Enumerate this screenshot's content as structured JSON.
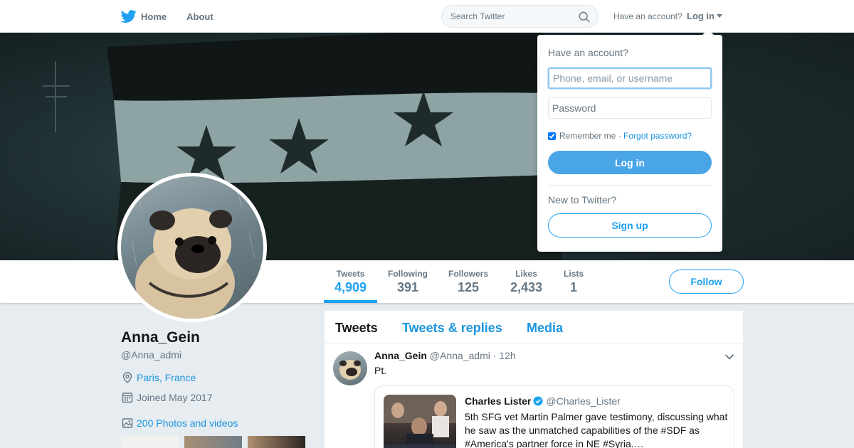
{
  "topnav": {
    "home_label": "Home",
    "about_label": "About",
    "search_placeholder": "Search Twitter",
    "have_account": "Have an account?",
    "login_label": "Log in"
  },
  "profile": {
    "name": "Anna_Gein",
    "handle": "@Anna_admi",
    "location": "Paris, France",
    "joined": "Joined May 2017",
    "photos_link": "200 Photos and videos"
  },
  "stats": [
    {
      "label": "Tweets",
      "value": "4,909",
      "active": true
    },
    {
      "label": "Following",
      "value": "391"
    },
    {
      "label": "Followers",
      "value": "125"
    },
    {
      "label": "Likes",
      "value": "2,433"
    },
    {
      "label": "Lists",
      "value": "1"
    }
  ],
  "follow_label": "Follow",
  "timeline": {
    "tabs": [
      "Tweets",
      "Tweets & replies",
      "Media"
    ],
    "tweet": {
      "name": "Anna_Gein",
      "handle": "@Anna_admi",
      "time": "· 12h",
      "text": "Pt.",
      "quote": {
        "name": "Charles Lister",
        "handle": "@Charles_Lister",
        "text": "5th SFG vet Martin Palmer gave testimony, discussing what he saw as the unmatched capabilities of the #SDF as #America's partner force in NE #Syria.…"
      }
    }
  },
  "login_dropdown": {
    "title": "Have an account?",
    "username_placeholder": "Phone, email, or username",
    "password_placeholder": "Password",
    "remember": "Remember me",
    "separator": "·",
    "forgot": "Forgot password?",
    "login_button": "Log in",
    "new_to": "New to Twitter?",
    "signup_button": "Sign up"
  },
  "colors": {
    "accent": "#1da1f2",
    "link": "#1b95e0",
    "login_button_bg": "#4aa5e7"
  },
  "icons": [
    "twitter-bird-icon",
    "home-icon",
    "search-icon",
    "caret-down-icon",
    "location-icon",
    "calendar-icon",
    "photo-icon",
    "chevron-down-icon",
    "verified-icon"
  ]
}
